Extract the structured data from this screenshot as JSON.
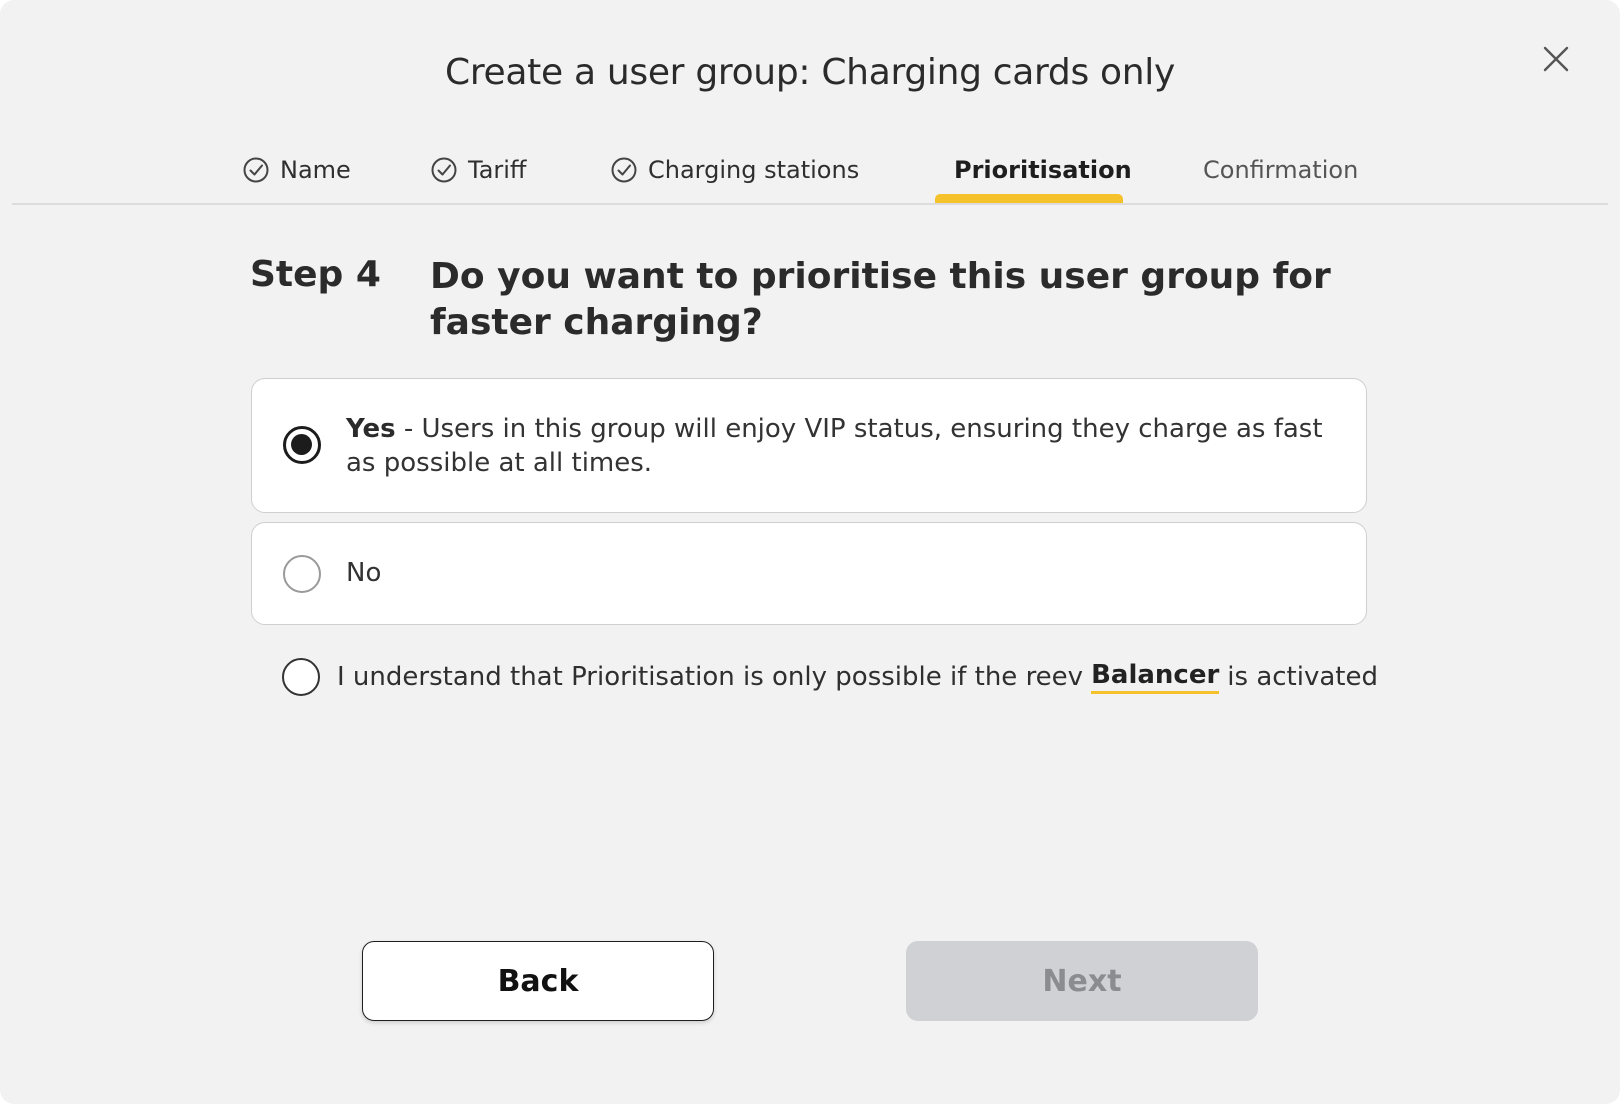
{
  "modal": {
    "title": "Create a user group: Charging cards only",
    "close_icon": "close-icon"
  },
  "tabs": [
    {
      "label": "Name",
      "state": "completed",
      "icon": "check-circle-icon"
    },
    {
      "label": "Tariff",
      "state": "completed",
      "icon": "check-circle-icon"
    },
    {
      "label": "Charging stations",
      "state": "completed",
      "icon": "check-circle-icon"
    },
    {
      "label": "Prioritisation",
      "state": "active"
    },
    {
      "label": "Confirmation",
      "state": "upcoming"
    }
  ],
  "step": {
    "label": "Step 4",
    "question": "Do you want to prioritise this user group for faster charging?"
  },
  "options": {
    "yes": {
      "label": "Yes",
      "description": " - Users in this group will enjoy VIP status, ensuring they charge as fast as possible at all times.",
      "selected": true
    },
    "no": {
      "label": "No",
      "selected": false
    }
  },
  "consent": {
    "text_before": "I understand that Prioritisation is only possible if the reev",
    "link_text": "Balancer",
    "text_after": "is activated",
    "checked": false
  },
  "buttons": {
    "back_label": "Back",
    "next_label": "Next",
    "next_disabled": true
  },
  "colors": {
    "accent": "#f5c22b",
    "background": "#f2f2f2",
    "disabled_button": "#cfd1d4"
  }
}
